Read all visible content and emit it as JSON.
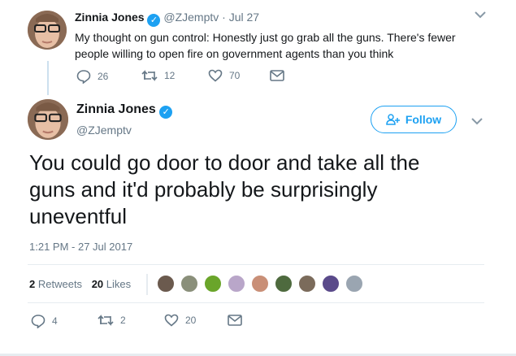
{
  "reply_tweet": {
    "display_name": "Zinnia Jones",
    "handle": "@ZJemptv",
    "separator": "·",
    "date": "Jul 27",
    "text_line1": "My thought on gun control: Honestly just go grab all the guns. There's fewer",
    "text_line2": "people willing to open fire on government agents than you think",
    "reply_count": "26",
    "retweet_count": "12",
    "like_count": "70"
  },
  "main_tweet": {
    "display_name": "Zinnia Jones",
    "handle": "@ZJemptv",
    "follow_label": "Follow",
    "text_line1": "You could go door to door and take all the",
    "text_line2": "guns and it'd probably be surprisingly",
    "text_line3": "uneventful",
    "timestamp": "1:21 PM - 27 Jul 2017",
    "retweets_count": "2",
    "retweets_label": "Retweets",
    "likes_count": "20",
    "likes_label": "Likes",
    "reply_count": "4",
    "retweet_count": "2",
    "like_count": "20"
  },
  "liker_avatar_colors": [
    "#6b5a4e",
    "#8a8f7a",
    "#6aa52a",
    "#b9a6c9",
    "#c98f77",
    "#4e6a3e",
    "#7b6b5b",
    "#5a4a8a",
    "#9aa5b1"
  ],
  "colors": {
    "accent": "#1da1f2",
    "muted": "#657786",
    "text": "#14171a"
  }
}
